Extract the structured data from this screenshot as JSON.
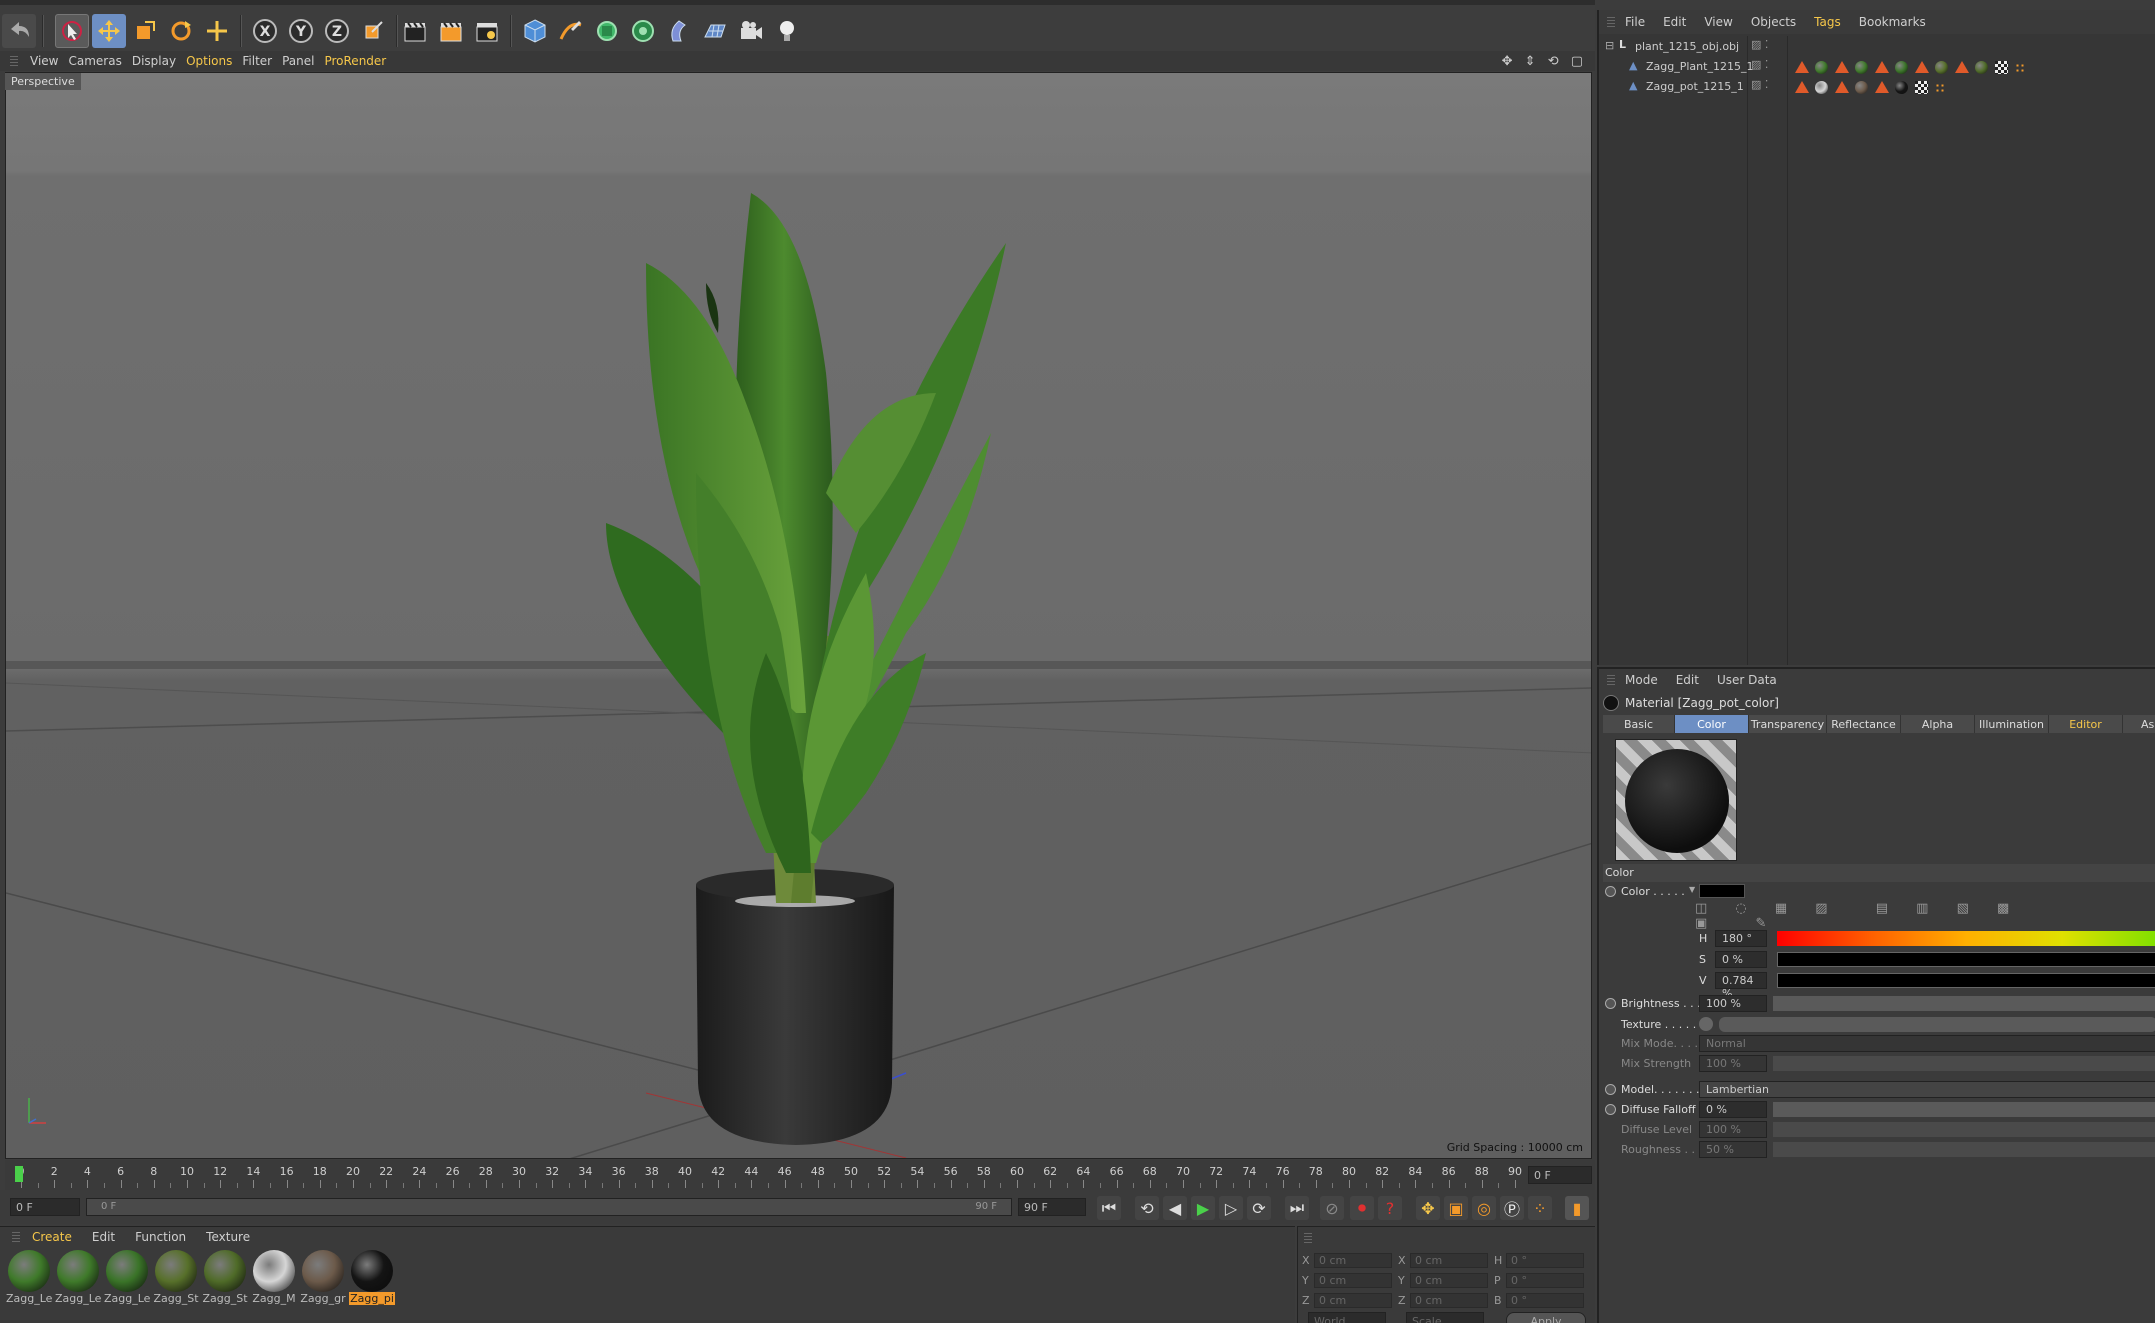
{
  "viewport_menu": [
    "View",
    "Cameras",
    "Display",
    "Options",
    "Filter",
    "Panel",
    "ProRender"
  ],
  "viewport_menu_highlight": [
    "Options",
    "ProRender"
  ],
  "viewport": {
    "label": "Perspective",
    "grid_spacing": "Grid Spacing : 10000 cm"
  },
  "timeline": {
    "ticks": [
      "0",
      "2",
      "4",
      "6",
      "8",
      "10",
      "12",
      "14",
      "16",
      "18",
      "20",
      "22",
      "24",
      "26",
      "28",
      "30",
      "32",
      "34",
      "36",
      "38",
      "40",
      "42",
      "44",
      "46",
      "48",
      "50",
      "52",
      "54",
      "56",
      "58",
      "60",
      "62",
      "64",
      "66",
      "68",
      "70",
      "72",
      "74",
      "76",
      "78",
      "80",
      "82",
      "84",
      "86",
      "88",
      "90"
    ],
    "current_frame": "0 F",
    "start_field": "0 F",
    "range_start": "0 F",
    "range_end": "90 F",
    "end_field": "90 F"
  },
  "material_manager": {
    "menu": [
      "Create",
      "Edit",
      "Function",
      "Texture"
    ],
    "materials": [
      {
        "name": "Zagg_Le",
        "color": "#3f7a2a"
      },
      {
        "name": "Zagg_Le",
        "color": "#3f7a2a"
      },
      {
        "name": "Zagg_Le",
        "color": "#3a7428"
      },
      {
        "name": "Zagg_St",
        "color": "#57702a"
      },
      {
        "name": "Zagg_St",
        "color": "#4f6b28"
      },
      {
        "name": "Zagg_M",
        "color": "#d6d6d6"
      },
      {
        "name": "Zagg_gr",
        "color": "#6c5a4a"
      },
      {
        "name": "Zagg_pi",
        "color": "#141414"
      }
    ]
  },
  "coordinates": {
    "rows": [
      {
        "a": "X",
        "av": "0 cm",
        "b": "X",
        "bv": "0 cm",
        "c": "H",
        "cv": "0 °"
      },
      {
        "a": "Y",
        "av": "0 cm",
        "b": "Y",
        "bv": "0 cm",
        "c": "P",
        "cv": "0 °"
      },
      {
        "a": "Z",
        "av": "0 cm",
        "b": "Z",
        "bv": "0 cm",
        "c": "B",
        "cv": "0 °"
      }
    ],
    "world": "World",
    "scale": "Scale",
    "apply": "Apply"
  },
  "object_manager": {
    "menu": [
      "File",
      "Edit",
      "View",
      "Objects",
      "Tags",
      "Bookmarks"
    ],
    "menu_highlight": "Tags",
    "objects": [
      {
        "name": "plant_1215_obj.obj",
        "indent": 0
      },
      {
        "name": "Zagg_Plant_1215_1",
        "indent": 1
      },
      {
        "name": "Zagg_pot_1215_1",
        "indent": 1
      }
    ]
  },
  "attribute_manager": {
    "menu": [
      "Mode",
      "Edit",
      "User Data"
    ],
    "title": "Material [Zagg_pot_color]",
    "tabs": [
      "Basic",
      "Color",
      "Transparency",
      "Reflectance",
      "Alpha",
      "Illumination",
      "Editor",
      "As"
    ],
    "active_tab": "Color",
    "section": "Color",
    "color_label": "Color . . . . .",
    "h_label": "H",
    "h_value": "180 °",
    "s_label": "S",
    "s_value": "0 %",
    "v_label": "V",
    "v_value": "0.784 %",
    "brightness_label": "Brightness . . .",
    "brightness_value": "100 %",
    "texture_label": "Texture . . . . . .",
    "mix_mode_label": "Mix Mode. . . .",
    "mix_mode_value": "Normal",
    "mix_strength_label": "Mix Strength",
    "mix_strength_value": "100 %",
    "model_label": "Model. . . . . . . .",
    "model_value": "Lambertian",
    "diffuse_falloff_label": "Diffuse Falloff",
    "diffuse_falloff_value": "0 %",
    "diffuse_level_label": "Diffuse Level",
    "diffuse_level_value": "100 %",
    "roughness_label": "Roughness . . .",
    "roughness_value": "50 %"
  },
  "colors": {
    "accent": "#f6c74a",
    "selection": "#f39a2b",
    "tab_active": "#6d8fc4",
    "material_color": "#000000"
  }
}
